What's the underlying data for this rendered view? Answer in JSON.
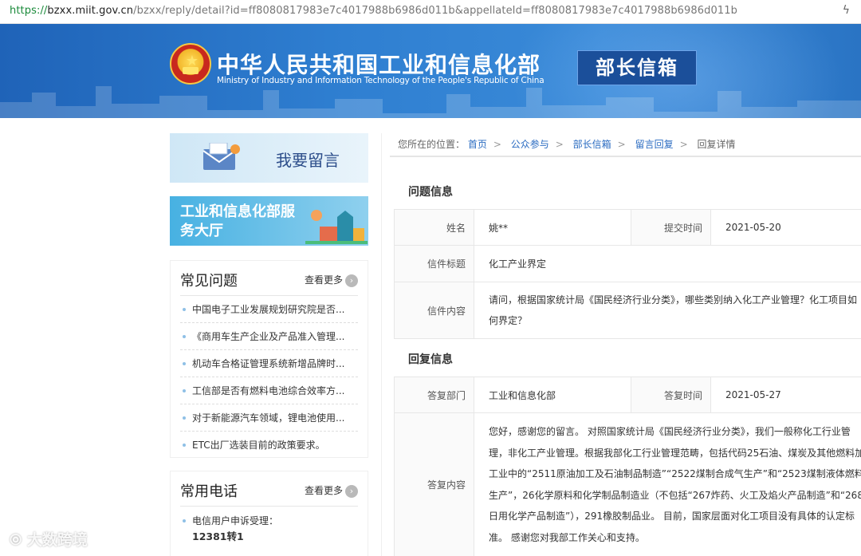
{
  "browser": {
    "url_scheme": "https://",
    "url_host": "bzxx.miit.gov.cn",
    "url_path": "/bzxx/reply/detail?id=ff8080817983e7c4017988b6986d011b&appellateId=ff8080817983e7c4017988b6986d011b",
    "right_icon": "lightning-icon"
  },
  "header": {
    "title_cn": "中华人民共和国工业和信息化部",
    "title_en": "Ministry of Industry and Information Technology of the People's Republic of China",
    "badge": "部长信箱",
    "bg_color": "#2a74c4"
  },
  "sidebar": {
    "leave_message_label": "我要留言",
    "service_hall_label": "工业和信息化部服务大厅",
    "faq": {
      "title": "常见问题",
      "more_label": "查看更多",
      "items": [
        "中国电子工业发展规划研究院是否...",
        "《商用车生产企业及产品准入管理...",
        "机动车合格证管理系统新增品牌时...",
        "工信部是否有燃料电池综合效率方...",
        "对于新能源汽车领域，锂电池使用...",
        "ETC出厂选装目前的政策要求。"
      ]
    },
    "phones": {
      "title": "常用电话",
      "more_label": "查看更多",
      "items": [
        {
          "label": "电信用户申诉受理：",
          "number": "12381转1"
        }
      ]
    }
  },
  "breadcrumb": {
    "prefix": "您所在的位置：",
    "items": [
      "首页",
      "公众参与",
      "部长信箱",
      "留言回复"
    ],
    "current": "回复详情",
    "separator": ">"
  },
  "question": {
    "section_title": "问题信息",
    "name_label": "姓名",
    "name_value": "姚**",
    "submit_time_label": "提交时间",
    "submit_time_value": "2021-05-20",
    "subject_label": "信件标题",
    "subject_value": "化工产业界定",
    "content_label": "信件内容",
    "content_value": "请问，根据国家统计局《国民经济行业分类》，哪些类别纳入化工产业管理？化工项目如何界定？"
  },
  "reply": {
    "section_title": "回复信息",
    "dept_label": "答复部门",
    "dept_value": "工业和信息化部",
    "time_label": "答复时间",
    "time_value": "2021-05-27",
    "content_label": "答复内容",
    "content_value": "您好，感谢您的留言。 对照国家统计局《国民经济行业分类》，我们一般称化工行业管理，非化工产业管理。根据我部化工行业管理范畴，包括代码25石油、煤炭及其他燃料加工业中的“2511原油加工及石油制品制造”“2522煤制合成气生产”和“2523煤制液体燃料生产”，26化学原料和化学制品制造业（不包括“267炸药、火工及焰火产品制造”和“268日用化学产品制造”），291橡胶制品业。 目前，国家层面对化工项目没有具体的认定标准。 感谢您对我部工作关心和支持。"
  },
  "watermark": "大数跨境"
}
